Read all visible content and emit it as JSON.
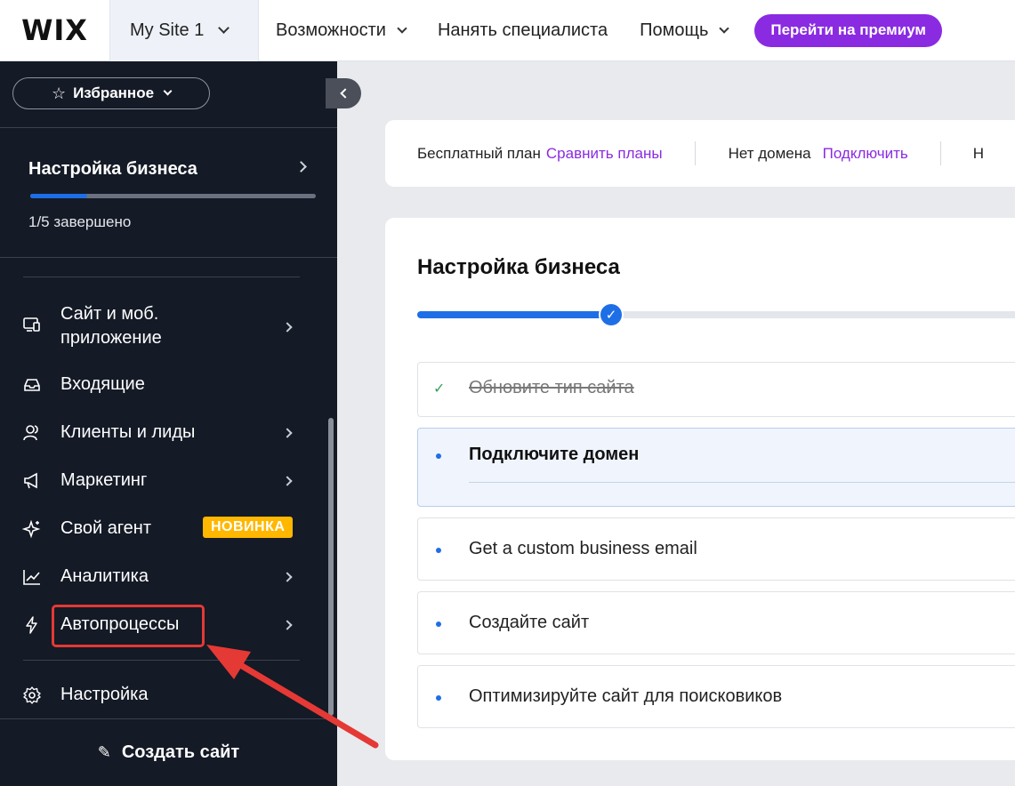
{
  "topbar": {
    "logo": "WIX",
    "site_name": "My Site 1",
    "nav": {
      "features": "Возможности",
      "hire": "Нанять специалиста",
      "help": "Помощь"
    },
    "premium_button": "Перейти на премиум"
  },
  "sidebar": {
    "favorites": "Избранное",
    "setup": {
      "title": "Настройка бизнеса",
      "status": "1/5 завершено",
      "progress": 0.2
    },
    "items": [
      {
        "label_line1": "Сайт и моб.",
        "label_line2": "приложение",
        "icon": "devices-icon"
      },
      {
        "label": "Входящие",
        "icon": "inbox-icon"
      },
      {
        "label": "Клиенты и лиды",
        "icon": "contacts-icon"
      },
      {
        "label": "Маркетинг",
        "icon": "megaphone-icon"
      },
      {
        "label": "Свой агент",
        "icon": "sparkle-icon",
        "badge": "НОВИНКА"
      },
      {
        "label": "Аналитика",
        "icon": "chart-icon"
      },
      {
        "label": "Автопроцессы",
        "icon": "lightning-icon"
      },
      {
        "label": "Настройка",
        "icon": "gear-icon"
      }
    ],
    "create_site": "Создать сайт"
  },
  "plan_bar": {
    "plan_text": "Бесплатный план",
    "plan_link": "Сравнить планы",
    "domain_text": "Нет домена",
    "domain_link": "Подключить",
    "trailing": "Н"
  },
  "setup_card": {
    "title": "Настройка бизнеса",
    "progress": 0.31,
    "tasks": [
      {
        "label": "Обновите тип сайта",
        "state": "done"
      },
      {
        "label": "Подключите домен",
        "state": "active"
      },
      {
        "label": "Get a custom business email",
        "state": "todo"
      },
      {
        "label": "Создайте сайт",
        "state": "todo"
      },
      {
        "label": "Оптимизируйте сайт для поисковиков",
        "state": "todo"
      }
    ]
  },
  "colors": {
    "sidebar_bg": "#141a26",
    "accent_blue": "#1e6fe6",
    "premium_purple": "#8a2be2",
    "badge_yellow": "#ffb700",
    "annotation_red": "#e53935"
  }
}
